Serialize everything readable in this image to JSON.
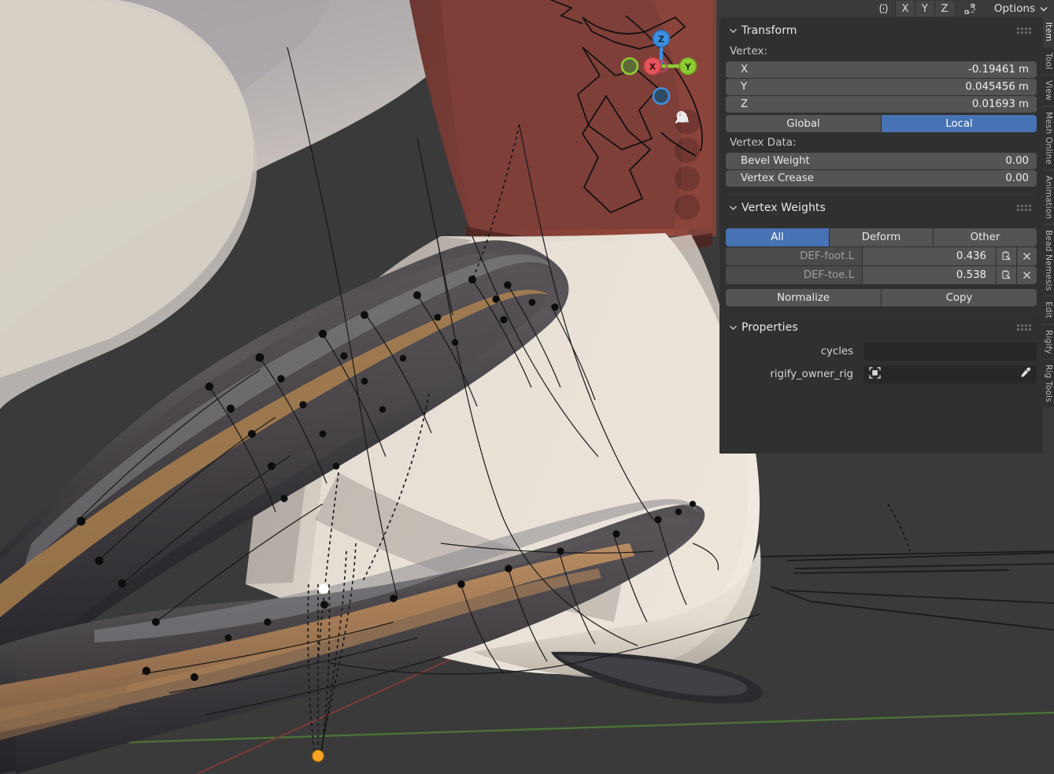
{
  "header": {
    "symmetry_icon": "mirror-icon",
    "axis_buttons": [
      "X",
      "Y",
      "Z"
    ],
    "proportional_icon": "proportional-editing-icon",
    "options_label": "Options",
    "options_chevron": "chevron-down-icon"
  },
  "viewport": {
    "axis_gizmo": {
      "x_label": "X",
      "y_label": "Y",
      "z_label": "Z",
      "x_color": "#e5545a",
      "y_color": "#8fcc33",
      "z_color": "#3d8fe0"
    },
    "nav_buttons": [
      {
        "name": "zoom-icon",
        "title": "Zoom"
      },
      {
        "name": "hand-icon",
        "title": "Move View"
      },
      {
        "name": "camera-icon",
        "title": "Camera View"
      },
      {
        "name": "grid-icon",
        "title": "Toggle Orthographic"
      }
    ],
    "colors": {
      "background": "#3a3a3a",
      "y_axis_line": "#5a8a3a",
      "x_axis_line": "#8a3a3a",
      "origin_dot": "#f5a623",
      "selected_vertex": "#ffffff",
      "cloth_red": "#7c3c36",
      "skin_light": "#b8b0ad",
      "boot_dark": "#3b3a3e",
      "sole_tan": "#b8906a"
    }
  },
  "sidebar": {
    "transform": {
      "title": "Transform",
      "chevron": "chevron-down-icon",
      "drag_handle": "drag-dots-icon",
      "vertex_label": "Vertex:",
      "fields": [
        {
          "key": "X",
          "value": "-0.19461 m"
        },
        {
          "key": "Y",
          "value": "0.045456 m"
        },
        {
          "key": "Z",
          "value": "0.01693 m"
        }
      ],
      "space_buttons": [
        {
          "label": "Global",
          "active": false
        },
        {
          "label": "Local",
          "active": true
        }
      ],
      "vertex_data_label": "Vertex Data:",
      "vertex_data": [
        {
          "key": "Bevel Weight",
          "value": "0.00"
        },
        {
          "key": "Vertex Crease",
          "value": "0.00"
        }
      ]
    },
    "vertex_weights": {
      "title": "Vertex Weights",
      "chevron": "chevron-down-icon",
      "drag_handle": "drag-dots-icon",
      "filter_tabs": [
        {
          "label": "All",
          "active": true
        },
        {
          "label": "Deform",
          "active": false
        },
        {
          "label": "Other",
          "active": false
        }
      ],
      "groups": [
        {
          "name": "DEF-foot.L",
          "weight": "0.436",
          "copy_icon": "copy-to-selected-icon",
          "delete_icon": "close-icon"
        },
        {
          "name": "DEF-toe.L",
          "weight": "0.538",
          "copy_icon": "copy-to-selected-icon",
          "delete_icon": "close-icon"
        }
      ],
      "actions": [
        {
          "label": "Normalize"
        },
        {
          "label": "Copy"
        }
      ]
    },
    "properties": {
      "title": "Properties",
      "chevron": "chevron-down-icon",
      "drag_handle": "drag-dots-icon",
      "rows": [
        {
          "label": "cycles",
          "value": "",
          "has_object_icon": false,
          "has_eyedropper": false
        },
        {
          "label": "rigify_owner_rig",
          "value": "",
          "has_object_icon": true,
          "has_eyedropper": true
        }
      ]
    }
  },
  "tabstrip": {
    "tabs": [
      {
        "label": "Item",
        "active": true
      },
      {
        "label": "Tool",
        "active": false
      },
      {
        "label": "View",
        "active": false
      },
      {
        "label": "Mesh Online",
        "active": false
      },
      {
        "label": "Animation",
        "active": false
      },
      {
        "label": "Bead Nemesis",
        "active": false
      },
      {
        "label": "Edit",
        "active": false
      },
      {
        "label": "Rigify",
        "active": false
      },
      {
        "label": "Rig Tools",
        "active": false
      }
    ]
  }
}
